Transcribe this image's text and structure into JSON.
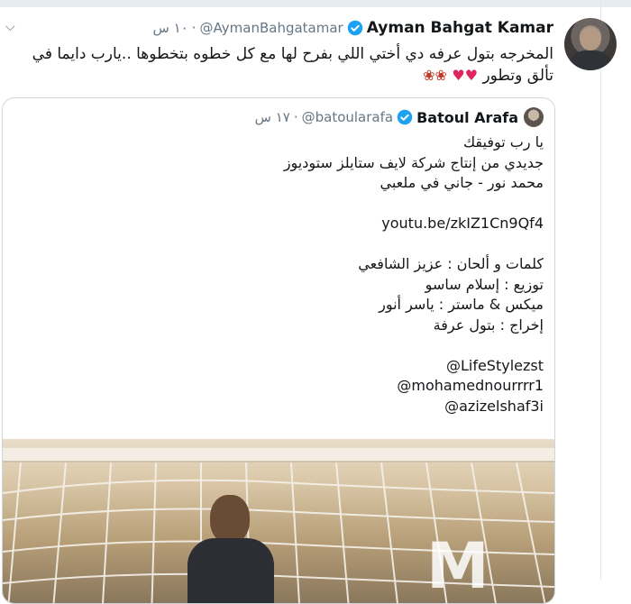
{
  "tweet": {
    "author_name": "Ayman Bahgat Kamar",
    "author_handle": "@AymanBahgatamar",
    "separator": "·",
    "time": "١٠ س",
    "text_line1": "المخرجه بتول عرفه دي أختي اللي بفرح لها مع كل خطوه بتخطوها ..يارب دايما في",
    "text_line2": "تألق وتطور",
    "icons": [
      "avatar",
      "verified-badge-icon",
      "chevron-down-icon",
      "red-heart-emoji",
      "rose-emoji"
    ],
    "colors": {
      "verified": "#1da1f2",
      "heart": "#e0245e",
      "rose": "#c0392b",
      "muted": "#657786"
    }
  },
  "quoted_tweet": {
    "author_name": "Batoul Arafa",
    "author_handle": "@batoularafa",
    "separator": "·",
    "time": "١٧ س",
    "lines": [
      "يا رب توفيقك",
      "جديدي من إنتاج شركة لايف ستايلز ستوديوز",
      "محمد نور - جاني في ملعبي",
      "",
      "youtu.be/zkIZ1Cn9Qf4",
      "",
      "كلمات و ألحان : عزيز الشافعي",
      "توزيع : إسلام ساسو",
      "ميكس & ماستر : ياسر أنور",
      "إخراج : بتول عرفة",
      "",
      "@LifeStylezst",
      "@mohamednourrrr1",
      "@azizelshaf3i"
    ]
  }
}
